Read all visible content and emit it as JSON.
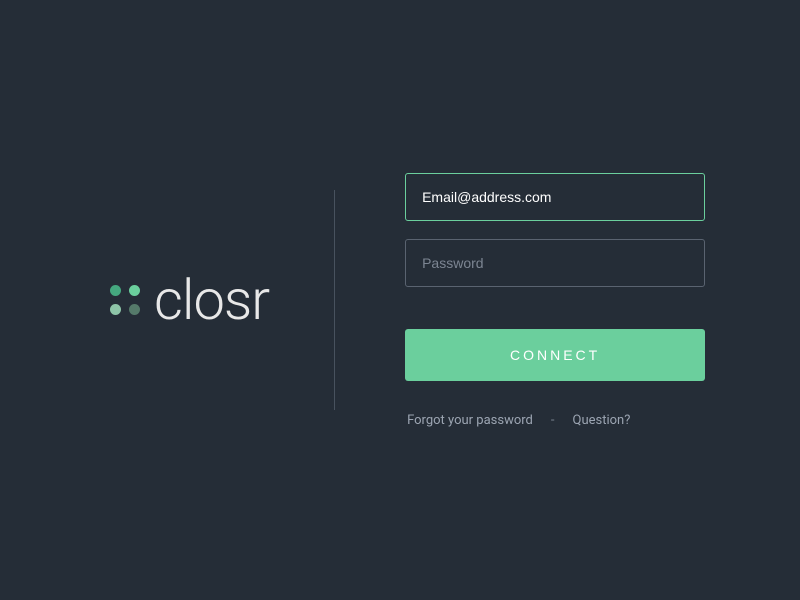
{
  "brand": {
    "name": "closr"
  },
  "form": {
    "email": {
      "value": "Email@address.com",
      "placeholder": "Email@address.com"
    },
    "password": {
      "placeholder": "Password"
    },
    "connect_label": "CONNECT"
  },
  "links": {
    "forgot_password": "Forgot your password",
    "separator": "-",
    "question": "Question?"
  },
  "colors": {
    "background": "#252d37",
    "accent": "#6bcf9d",
    "border_default": "#5a6370",
    "text_muted": "#7c8592"
  }
}
